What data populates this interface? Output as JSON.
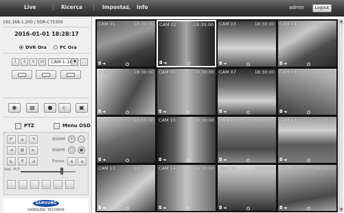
{
  "nav": {
    "items": [
      "Live",
      "Ricerca",
      "Impostaz.",
      "Info"
    ],
    "separator": "|",
    "user": "admin",
    "logout": "Logout"
  },
  "left": {
    "ip_model": "192.168.1.200 / SDR-C75300",
    "datetime": "2016-01-01 18:28:17",
    "radio_dvr": "DVR Ora",
    "radio_pc": "PC Ora",
    "view_buttons": [
      "1",
      "4",
      "9",
      "16"
    ],
    "camera_select": "CAM 1-16",
    "ptz_tab": "PTZ",
    "menu_osd_tab": "Menu OSD",
    "ptz_labels": {
      "zoom": "ZOOM",
      "diafr": "DIAFR",
      "focus": "Focus"
    },
    "velocity_label": "Vel. P/T",
    "velocity_level": 0.75,
    "logo_text": "SAMSUNG",
    "logo_sub": "SAMSUNG TECHWIN"
  },
  "cameras": [
    {
      "label": "CAM 01",
      "time": "18:30:00"
    },
    {
      "label": "CAM 02",
      "time": "18:30:00"
    },
    {
      "label": "CAM 03",
      "time": "18:30:00"
    },
    {
      "label": "CAM 04",
      "time": "18:30:00"
    },
    {
      "label": "CAM 05",
      "time": "18:30:00"
    },
    {
      "label": "CAM 06",
      "time": "18:30:00"
    },
    {
      "label": "CAM 07",
      "time": "18:30:00"
    },
    {
      "label": "CAM 08",
      "time": "18:30:00"
    },
    {
      "label": "CAM 09",
      "time": "18:30:00"
    },
    {
      "label": "CAM 10",
      "time": "18:30:00"
    },
    {
      "label": "CAM 11",
      "time": "18:30:00"
    },
    {
      "label": "CAM 12",
      "time": "18:30:00"
    },
    {
      "label": "CAM 13",
      "time": "18:30:00"
    },
    {
      "label": "CAM 14",
      "time": "18:30:00"
    },
    {
      "label": "CAM 15",
      "time": "18:30:00"
    },
    {
      "label": "CAM 16",
      "time": "18:30:00"
    }
  ],
  "selected_camera": "CAM 02"
}
